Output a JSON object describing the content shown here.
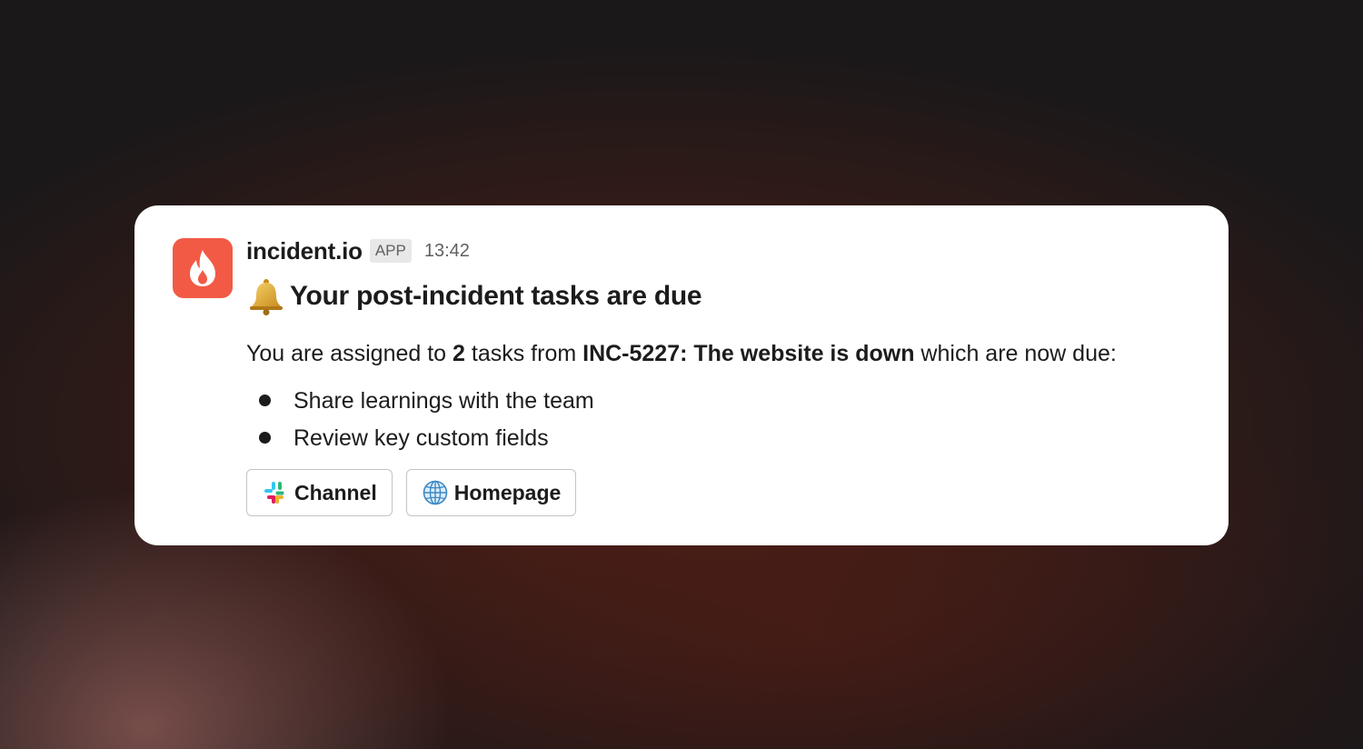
{
  "message": {
    "app_name": "incident.io",
    "app_badge": "APP",
    "timestamp": "13:42",
    "title": "Your post-incident tasks are due",
    "body": {
      "prefix": "You are assigned to ",
      "count": "2",
      "middle": " tasks from ",
      "incident": "INC-5227: The website is down",
      "suffix": " which are now due:"
    },
    "tasks": [
      "Share learnings with the team",
      "Review key custom fields"
    ],
    "buttons": {
      "channel_label": "Channel",
      "homepage_label": "Homepage"
    },
    "icons": {
      "avatar": "flame-icon",
      "title": "bell-icon",
      "channel": "slack-icon",
      "homepage": "globe-icon"
    }
  },
  "colors": {
    "brand": "#f25a45",
    "text": "#1d1c1d",
    "muted": "#616061"
  }
}
